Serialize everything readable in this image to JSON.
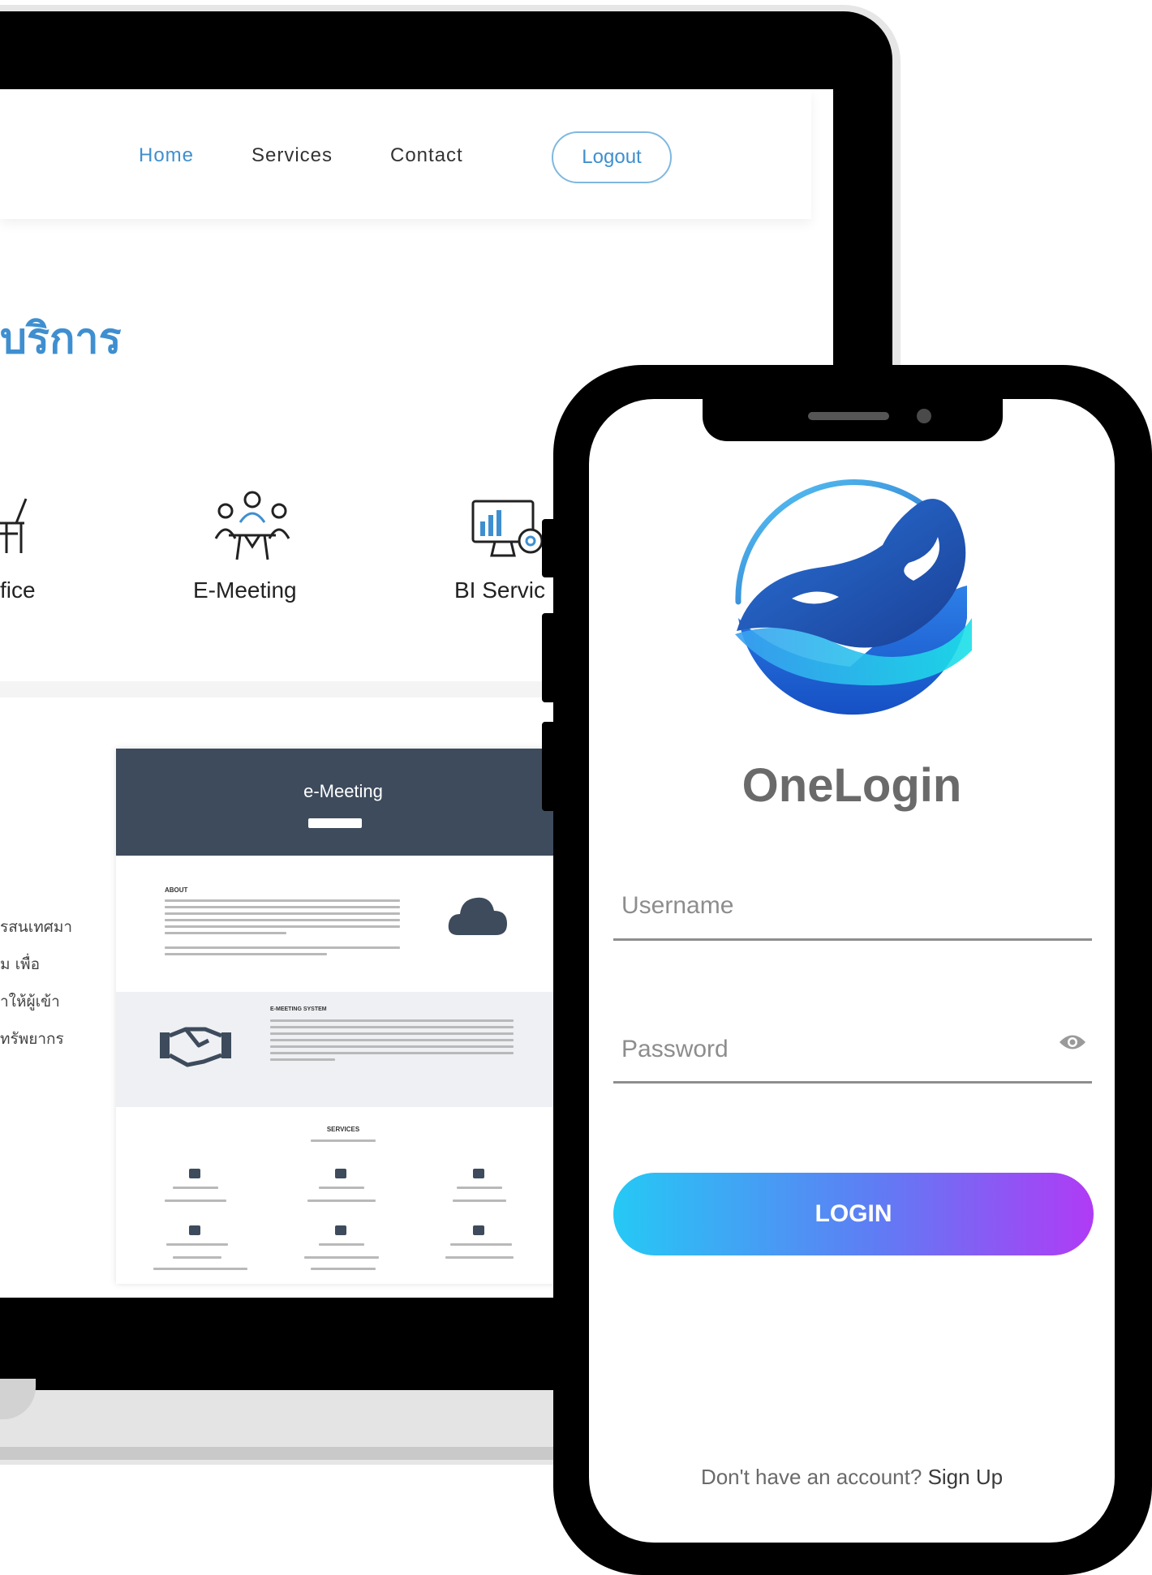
{
  "laptop": {
    "nav": {
      "home": "Home",
      "services": "Services",
      "contact": "Contact",
      "logout": "Logout"
    },
    "heading": "บริการ",
    "services": [
      {
        "label": "fice",
        "icon": "office-desk-icon"
      },
      {
        "label": "E-Meeting",
        "icon": "meeting-people-icon"
      },
      {
        "label": "BI Servic",
        "icon": "bi-dashboard-icon"
      }
    ],
    "description_lines": [
      "รสนเทศมา",
      "ุม เพื่อ",
      "าให้ผู้เข้า",
      "ทรัพยากร"
    ],
    "preview": {
      "title": "e-Meeting",
      "about_heading": "ABOUT",
      "system_heading": "E-MEETING SYSTEM",
      "services_heading": "SERVICES",
      "icons": [
        "cloud-icon",
        "handshake-icon",
        "calendar-icon",
        "briefcase-icon",
        "qr-code-icon",
        "users-icon",
        "sign-in-icon",
        "document-icon"
      ]
    }
  },
  "phone": {
    "brand": "OneLogin",
    "username_placeholder": "Username",
    "password_placeholder": "Password",
    "login_label": "LOGIN",
    "signup_prompt": "Don't have an account?",
    "signup_link": "Sign Up"
  },
  "colors": {
    "accent_blue": "#3f8fd0",
    "gradient_start": "#25c9f5",
    "gradient_end": "#b03bf5",
    "preview_header": "#3d4b5c"
  }
}
